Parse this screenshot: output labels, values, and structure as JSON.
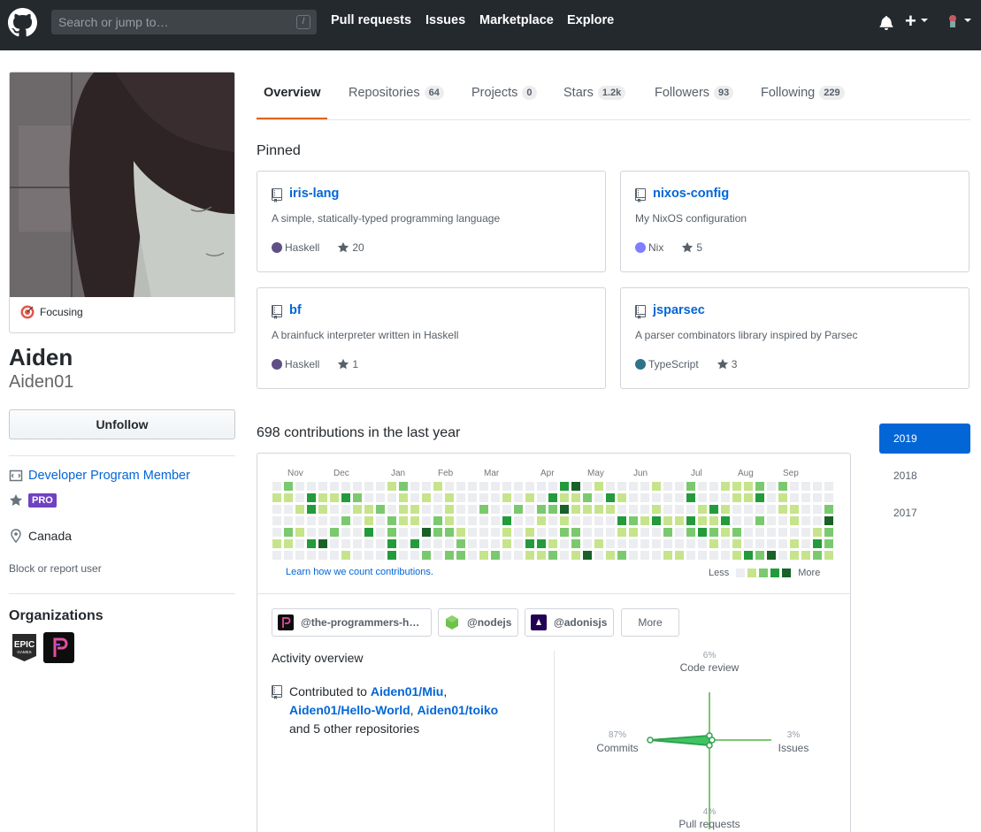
{
  "header": {
    "search_placeholder": "Search or jump to…",
    "search_key": "/",
    "nav": [
      "Pull requests",
      "Issues",
      "Marketplace",
      "Explore"
    ],
    "plus": "+"
  },
  "profile": {
    "status": "Focusing",
    "full_name": "Aiden",
    "username": "Aiden01",
    "follow_button": "Unfollow",
    "developer_program": "Developer Program Member",
    "pro_badge": "PRO",
    "location": "Canada",
    "block_link": "Block or report user",
    "organizations_title": "Organizations",
    "organizations": [
      "epic-games",
      "the-programmers-hangout"
    ]
  },
  "tabs": [
    {
      "label": "Overview",
      "count": null
    },
    {
      "label": "Repositories",
      "count": "64"
    },
    {
      "label": "Projects",
      "count": "0"
    },
    {
      "label": "Stars",
      "count": "1.2k"
    },
    {
      "label": "Followers",
      "count": "93"
    },
    {
      "label": "Following",
      "count": "229"
    }
  ],
  "pinned": {
    "title": "Pinned",
    "repos": [
      {
        "name": "iris-lang",
        "description": "A simple, statically-typed programming language",
        "language": "Haskell",
        "lang_color": "#5e5086",
        "stars": "20"
      },
      {
        "name": "nixos-config",
        "description": "My NixOS configuration",
        "language": "Nix",
        "lang_color": "#7e7eff",
        "stars": "5"
      },
      {
        "name": "bf",
        "description": "A brainfuck interpreter written in Haskell",
        "language": "Haskell",
        "lang_color": "#5e5086",
        "stars": "1"
      },
      {
        "name": "jsparsec",
        "description": "A parser combinators library inspired by Parsec",
        "language": "TypeScript",
        "lang_color": "#2b7489",
        "stars": "3"
      }
    ]
  },
  "contributions": {
    "title": "698 contributions in the last year",
    "months": [
      "Nov",
      "Dec",
      "Jan",
      "Feb",
      "Mar",
      "Apr",
      "May",
      "Jun",
      "Jul",
      "Aug",
      "Sep"
    ],
    "learn_link": "Learn how we count contributions.",
    "legend_less": "Less",
    "legend_more": "More",
    "colors": [
      "#ebedf0",
      "#c6e48b",
      "#7bc96f",
      "#239a3b",
      "#196127"
    ]
  },
  "activity": {
    "org_filters": [
      "@the-programmers-h…",
      "@nodejs",
      "@adonisjs"
    ],
    "more": "More",
    "title": "Activity overview",
    "contributed_prefix": "Contributed to",
    "repos": [
      "Aiden01/Miu",
      "Aiden01/Hello-World",
      "Aiden01/toiko"
    ],
    "suffix": "and 5 other repositories",
    "radar": {
      "code_review": {
        "label": "Code review",
        "pct": "6%"
      },
      "issues": {
        "label": "Issues",
        "pct": "3%"
      },
      "commits": {
        "label": "Commits",
        "pct": "87%"
      },
      "pull_requests": {
        "label": "Pull requests",
        "pct": "4%"
      }
    }
  },
  "years": [
    "2019",
    "2018",
    "2017"
  ],
  "selected_year": "2019"
}
